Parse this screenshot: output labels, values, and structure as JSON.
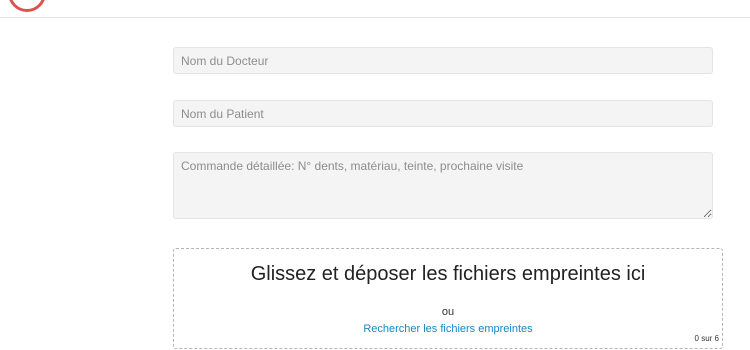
{
  "form": {
    "doctor_placeholder": "Nom du Docteur",
    "patient_placeholder": "Nom du Patient",
    "order_placeholder": "Commande détaillée: N° dents, matériau, teinte, prochaine visite"
  },
  "dropzone": {
    "title": "Glissez et déposer les fichiers empreintes ici",
    "or_text": "ou",
    "browse_link": "Rechercher les fichiers empreintes",
    "file_count": "0 sur 6"
  },
  "colors": {
    "accent": "#1a86c0",
    "logo_ring": "#d9534f"
  }
}
